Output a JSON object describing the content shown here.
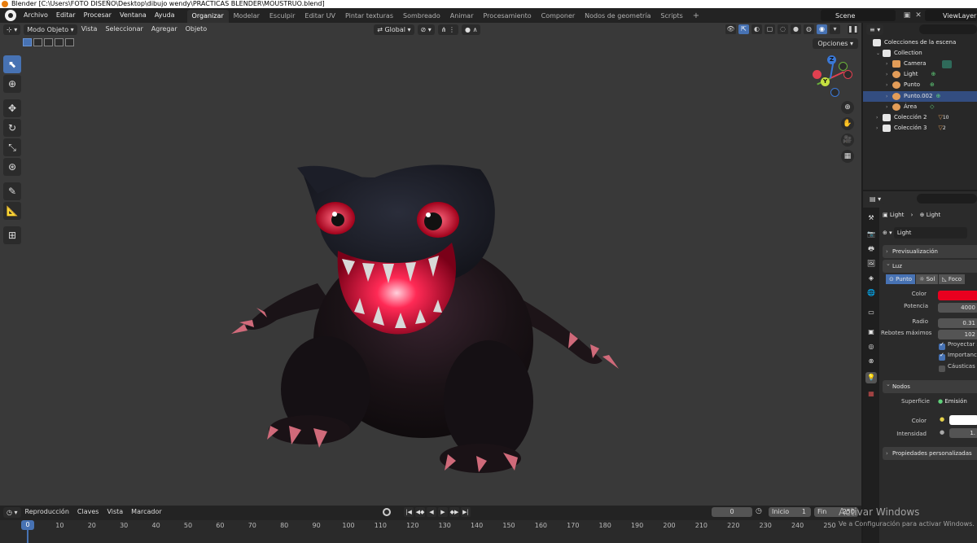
{
  "window": {
    "title": "Blender [C:\\Users\\FOTO DISEÑO\\Desktop\\dibujo wendy\\PRACTICAS BLENDER\\MOUSTRUO.blend]"
  },
  "menu": [
    "Archivo",
    "Editar",
    "Procesar",
    "Ventana",
    "Ayuda"
  ],
  "workspaces": [
    "Organizar",
    "Modelar",
    "Esculpir",
    "Editar UV",
    "Pintar texturas",
    "Sombreado",
    "Animar",
    "Procesamiento",
    "Componer",
    "Nodos de geometría",
    "Scripts"
  ],
  "workspace_active": "Organizar",
  "scene": {
    "name": "Scene",
    "view_layer": "ViewLayer"
  },
  "viewport": {
    "mode": "Modo Objeto",
    "menus": [
      "Vista",
      "Seleccionar",
      "Agregar",
      "Objeto"
    ],
    "transform_orientation": "Global",
    "options": "Opciones",
    "gizmo": {
      "x": "X",
      "y": "Y",
      "z": "Z"
    }
  },
  "outliner": {
    "title": "Colecciones de la escena",
    "rows": [
      {
        "label": "Collection"
      },
      {
        "label": "Camera"
      },
      {
        "label": "Light"
      },
      {
        "label": "Punto"
      },
      {
        "label": "Punto.002"
      },
      {
        "label": "Área"
      },
      {
        "label": "Colección 2",
        "count": "10"
      },
      {
        "label": "Colección 3",
        "count": "2"
      }
    ]
  },
  "properties": {
    "breadcrumb_1": "Light",
    "breadcrumb_2": "Light",
    "datablock": "Light",
    "panel_preview": "Previsualización",
    "panel_luz": "Luz",
    "light_types": [
      "Punto",
      "Sol",
      "Foco"
    ],
    "color_label": "Color",
    "potencia_label": "Potencia",
    "potencia_value": "4000",
    "radio_label": "Radio",
    "radio_value": "0.31",
    "rebotes_label": "Rebotes máximos",
    "rebotes_value": "102",
    "chk1": "Proyectar s",
    "chk2": "Importanci",
    "chk3": "Cáusticas d",
    "panel_nodos": "Nodos",
    "superficie_label": "Superficie",
    "superficie_value": "Emisión",
    "color2_label": "Color",
    "intensidad_label": "Intensidad",
    "intensidad_value": "1.",
    "panel_custom": "Propiedades personalizadas",
    "light_color": "#e8001f"
  },
  "timeline": {
    "menus": [
      "Reproducción",
      "Claves",
      "Vista",
      "Marcador"
    ],
    "current_frame": "0",
    "inicio_label": "Inicio",
    "inicio_value": "1",
    "fin_label": "Fin",
    "fin_value": "250",
    "ticks": [
      "10",
      "20",
      "30",
      "40",
      "50",
      "60",
      "70",
      "80",
      "90",
      "100",
      "110",
      "120",
      "130",
      "140",
      "150",
      "160",
      "170",
      "180",
      "190",
      "200",
      "210",
      "220",
      "230",
      "240",
      "250"
    ],
    "cursor": "0"
  },
  "watermark": {
    "line1": "Activar Windows",
    "line2": "Ve a Configuración para activar Windows."
  }
}
